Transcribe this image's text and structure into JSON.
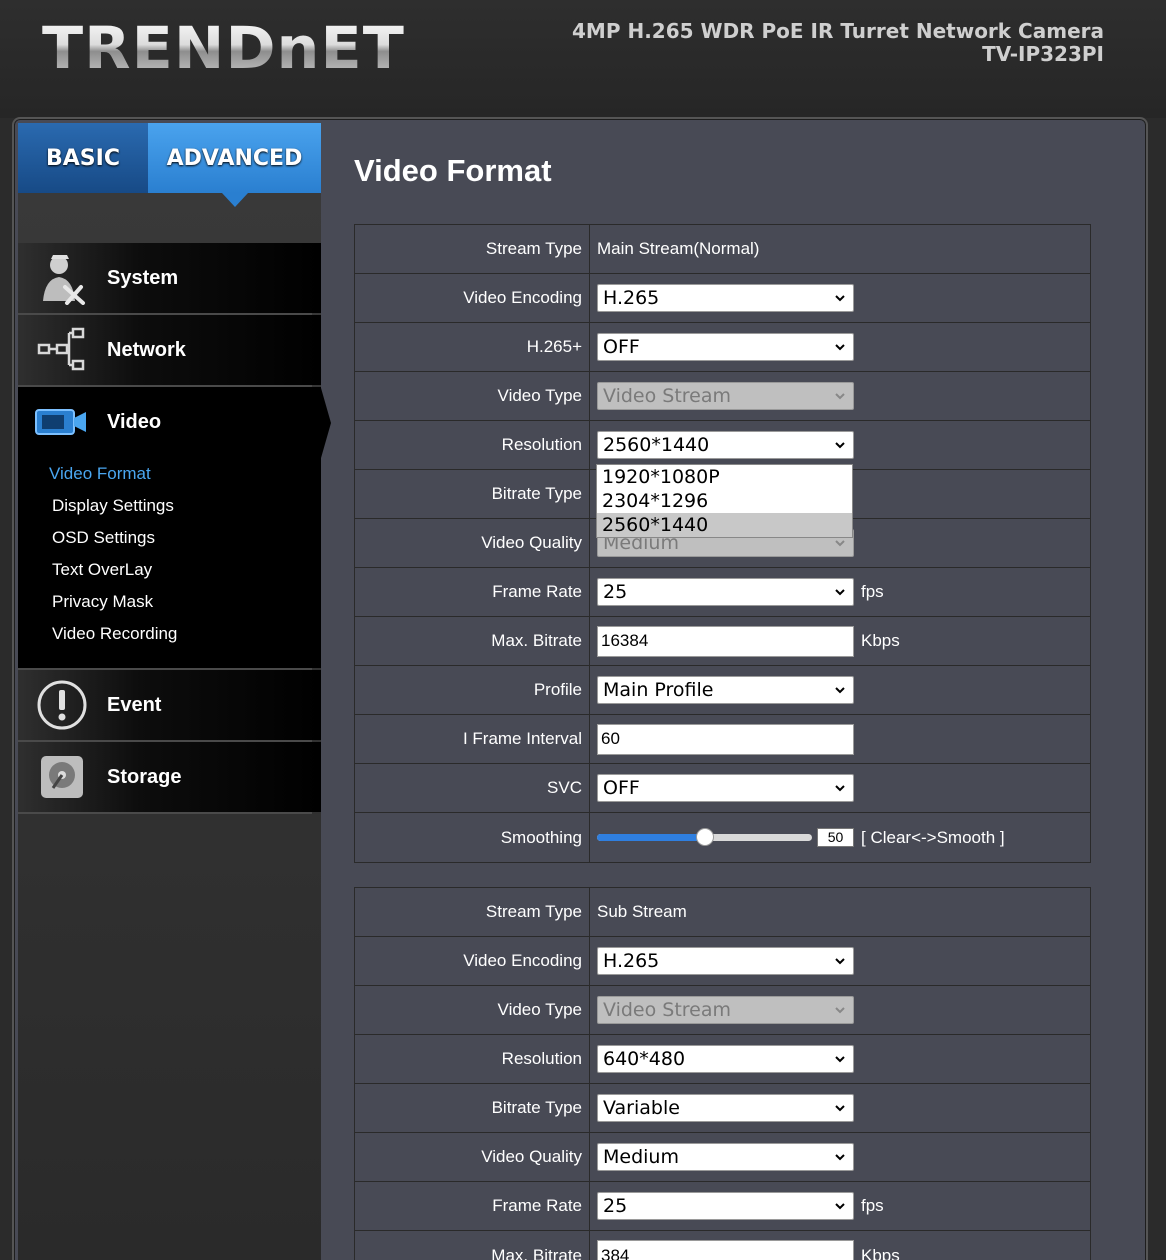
{
  "header": {
    "logo": "TRENDnET",
    "product_line1": "4MP H.265 WDR PoE IR Turret Network Camera",
    "product_line2": "TV-IP323PI"
  },
  "tabs": {
    "basic": "BASIC",
    "advanced": "ADVANCED"
  },
  "menu": {
    "system": "System",
    "network": "Network",
    "video": "Video",
    "event": "Event",
    "storage": "Storage",
    "video_sub": [
      "Video Format",
      "Display Settings",
      "OSD Settings",
      "Text OverLay",
      "Privacy Mask",
      "Video Recording"
    ]
  },
  "page_title": "Video Format",
  "main_stream": {
    "stream_type_label": "Stream Type",
    "stream_type": "Main Stream(Normal)",
    "video_encoding_label": "Video Encoding",
    "video_encoding": "H.265",
    "h265plus_label": "H.265+",
    "h265plus": "OFF",
    "video_type_label": "Video Type",
    "video_type": "Video Stream",
    "resolution_label": "Resolution",
    "resolution": "2560*1440",
    "resolution_options": [
      "1920*1080P",
      "2304*1296",
      "2560*1440"
    ],
    "bitrate_type_label": "Bitrate Type",
    "video_quality_label": "Video Quality",
    "video_quality": "Medium",
    "frame_rate_label": "Frame Rate",
    "frame_rate": "25",
    "frame_rate_unit": "fps",
    "max_bitrate_label": "Max. Bitrate",
    "max_bitrate": "16384",
    "max_bitrate_unit": "Kbps",
    "profile_label": "Profile",
    "profile": "Main Profile",
    "iframe_label": "I Frame Interval",
    "iframe": "60",
    "svc_label": "SVC",
    "svc": "OFF",
    "smoothing_label": "Smoothing",
    "smoothing": "50",
    "smoothing_hint": "[ Clear<->Smooth ]",
    "smoothing_fraction": 0.5
  },
  "sub_stream": {
    "stream_type_label": "Stream Type",
    "stream_type": "Sub Stream",
    "video_encoding_label": "Video Encoding",
    "video_encoding": "H.265",
    "video_type_label": "Video Type",
    "video_type": "Video Stream",
    "resolution_label": "Resolution",
    "resolution": "640*480",
    "bitrate_type_label": "Bitrate Type",
    "bitrate_type": "Variable",
    "video_quality_label": "Video Quality",
    "video_quality": "Medium",
    "frame_rate_label": "Frame Rate",
    "frame_rate": "25",
    "frame_rate_unit": "fps",
    "max_bitrate_label": "Max. Bitrate",
    "max_bitrate": "384",
    "max_bitrate_unit": "Kbps"
  },
  "colors": {
    "accent": "#2a7fd0",
    "active_sub": "#4aa6f0",
    "panel": "#484a55"
  }
}
